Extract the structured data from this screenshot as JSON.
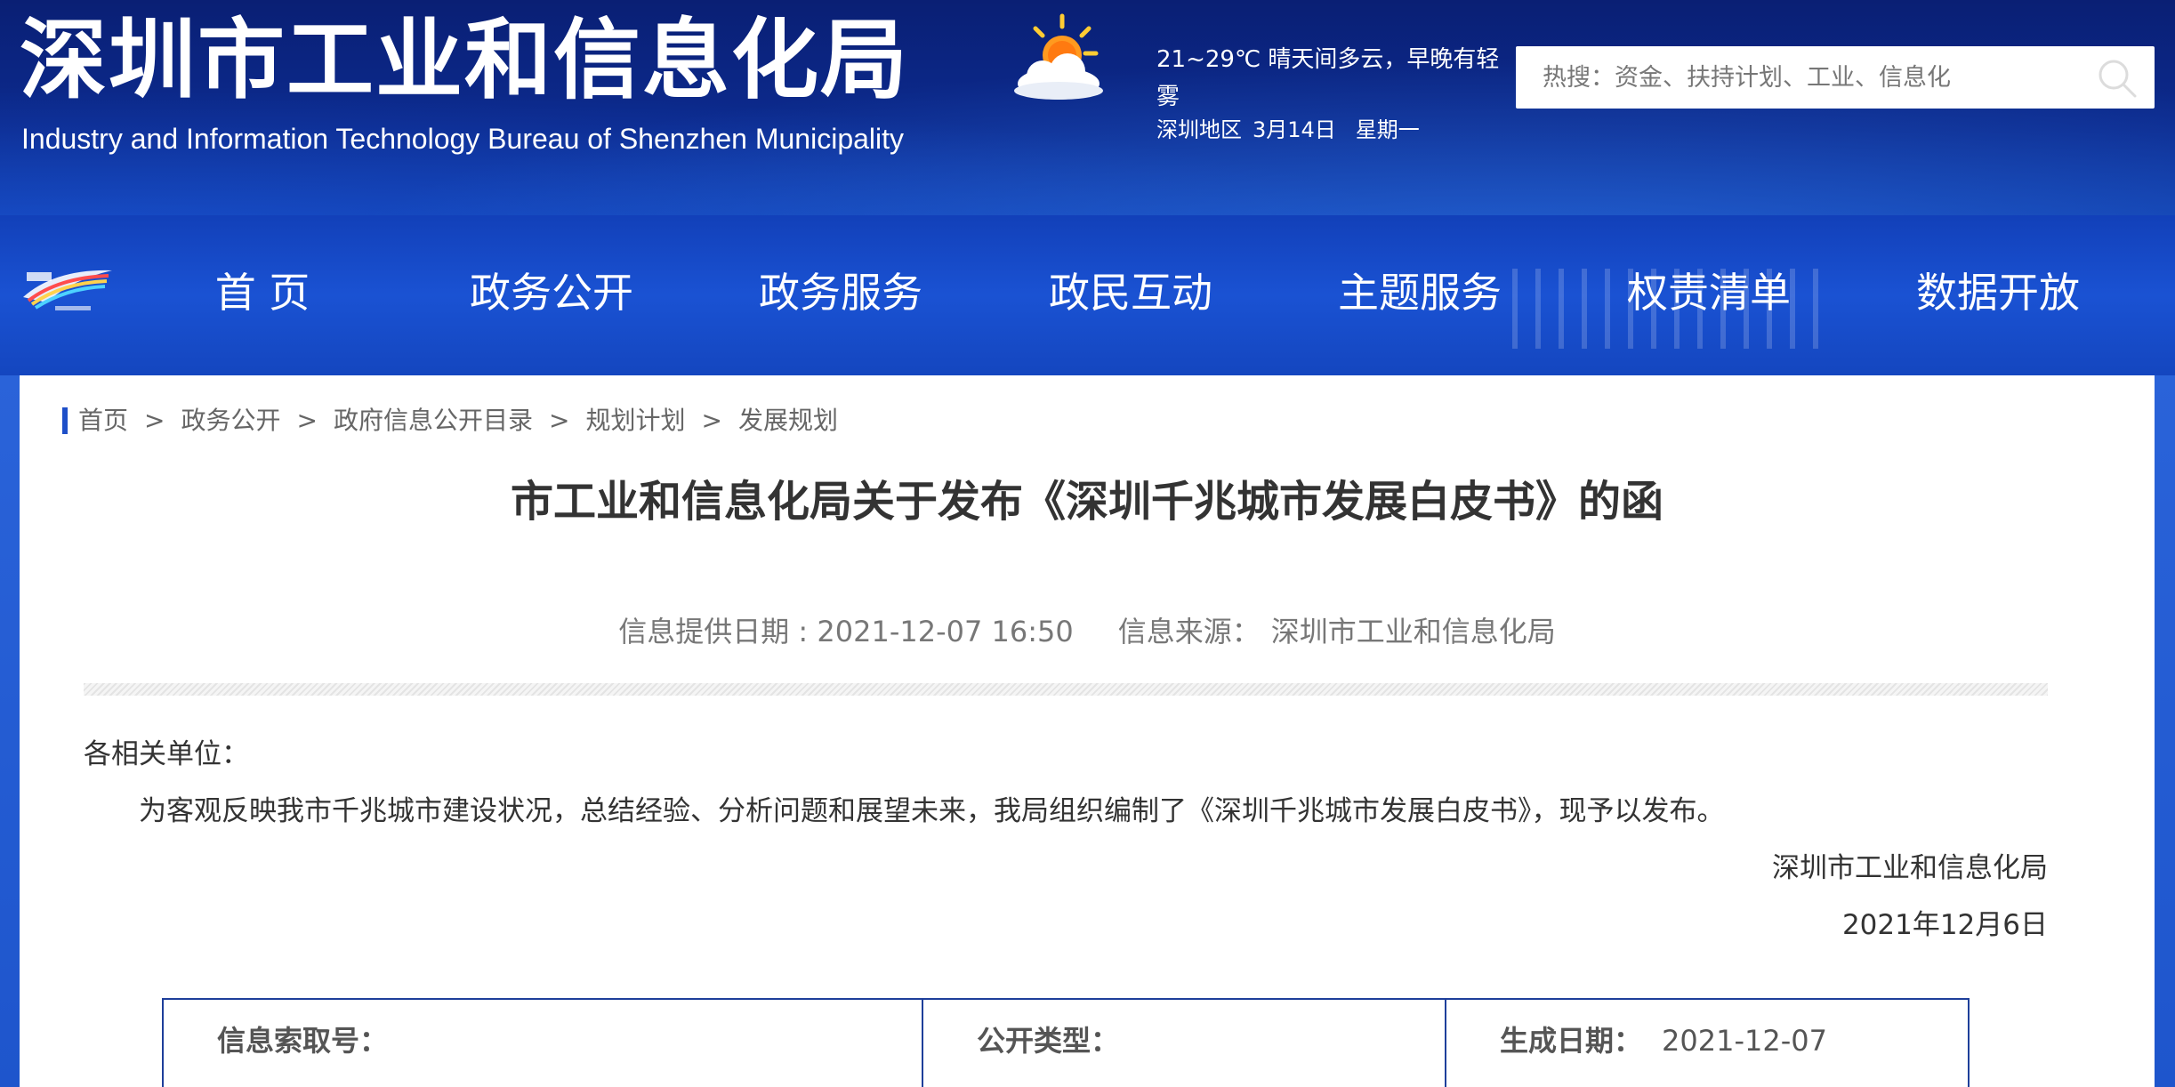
{
  "header": {
    "title": "深圳市工业和信息化局",
    "subtitle": "Industry and Information Technology Bureau of Shenzhen Municipality",
    "weather": {
      "icon": "partly-cloudy-icon",
      "summary": "21~29℃ 晴天间多云，早晚有轻雾",
      "region": "深圳地区",
      "date": "3月14日",
      "weekday": "星期一"
    },
    "search": {
      "placeholder": "热搜：资金、扶持计划、工业、信息化",
      "icon": "search-icon"
    }
  },
  "nav": {
    "logo": "shenzhen-logo",
    "items": [
      {
        "label": "首 页"
      },
      {
        "label": "政务公开"
      },
      {
        "label": "政务服务"
      },
      {
        "label": "政民互动"
      },
      {
        "label": "主题服务"
      },
      {
        "label": "权责清单"
      },
      {
        "label": "数据开放"
      }
    ]
  },
  "breadcrumb": [
    "首页",
    "政务公开",
    "政府信息公开目录",
    "规划计划",
    "发展规划"
  ],
  "breadcrumb_separator": ">",
  "article": {
    "title": "市工业和信息化局关于发布《深圳千兆城市发展白皮书》的函",
    "date_label": "信息提供日期 : ",
    "date": "2021-12-07 16:50",
    "source_label": "信息来源：",
    "source": "深圳市工业和信息化局",
    "salutation": "各相关单位：",
    "paragraph": "为客观反映我市千兆城市建设状况，总结经验、分析问题和展望未来，我局组织编制了《深圳千兆城市发展白皮书》，现予以发布。",
    "sign_org": "深圳市工业和信息化局",
    "sign_date": "2021年12月6日"
  },
  "info_table": {
    "index_label": "信息索取号：",
    "index_value": "",
    "type_label": "公开类型：",
    "type_value": "",
    "created_label": "生成日期：",
    "created_value": "2021-12-07"
  },
  "colors": {
    "header_bg": "#0c2b8f",
    "nav_bg": "#1a52d3",
    "accent": "#1e4fc8",
    "table_border": "#1e3f9a"
  }
}
